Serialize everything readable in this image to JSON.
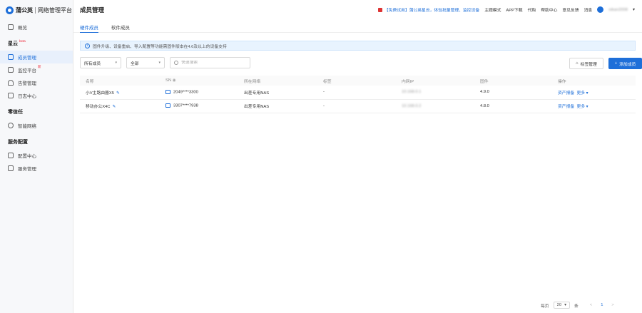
{
  "brand": {
    "name": "蒲公英",
    "subtitle": "网络管理平台"
  },
  "sidebar": {
    "items": [
      {
        "label": "概览"
      }
    ],
    "group_cloud": {
      "label": "星云",
      "badge": "beta"
    },
    "cloud_items": [
      {
        "label": "成员管理",
        "active": true
      },
      {
        "label": "监控平台",
        "badge": "新"
      },
      {
        "label": "告警管理"
      },
      {
        "label": "日志中心"
      }
    ],
    "group_zerotrust": {
      "label": "零信任"
    },
    "zerotrust_items": [
      {
        "label": "智能网络"
      }
    ],
    "group_service": {
      "label": "服务配置"
    },
    "service_items": [
      {
        "label": "配置中心"
      },
      {
        "label": "服务管理"
      }
    ]
  },
  "header": {
    "title": "成员管理",
    "promo": "【免费试用】蒲公英星云，体验批量管理、监控设备",
    "links": [
      "主题模式",
      "APP下载",
      "代购",
      "帮助中心",
      "意见反馈",
      "消息"
    ],
    "user": "oikan2008"
  },
  "tabs": [
    {
      "label": "硬件成员",
      "active": true
    },
    {
      "label": "软件成员"
    }
  ],
  "notice": "固件升级、设备重启、导入配置等功能需固件版本在4.6及以上的设备支持",
  "filters": {
    "member_type": "所有成员",
    "scope": "全部",
    "search_placeholder": "快速搜索",
    "tag_button": "标签管理",
    "add_button": "添加成员"
  },
  "table": {
    "headers": [
      "名称",
      "SN",
      "所在网络",
      "标签",
      "内网IP",
      "固件",
      "操作"
    ],
    "rows": [
      {
        "name": "小V主路由器X5",
        "sn": "2049****3300",
        "network": "出差专用NAS",
        "tag": "-",
        "ip": "10.168.0.1",
        "firmware": "4.9.0",
        "action1": "资产报备",
        "action2": "更多"
      },
      {
        "name": "移动办公X4C",
        "sn": "3307****7938",
        "network": "出差专用NAS",
        "tag": "-",
        "ip": "10.168.0.2",
        "firmware": "4.8.0",
        "action1": "资产报备",
        "action2": "更多"
      }
    ]
  },
  "pagination": {
    "per_page_label": "每页",
    "page_size": "20",
    "unit": "条",
    "current": "1",
    "prev": "<",
    "next": ">"
  },
  "colors": {
    "accent": "#1e6fd9",
    "notice_bg": "#e8f3fe"
  }
}
